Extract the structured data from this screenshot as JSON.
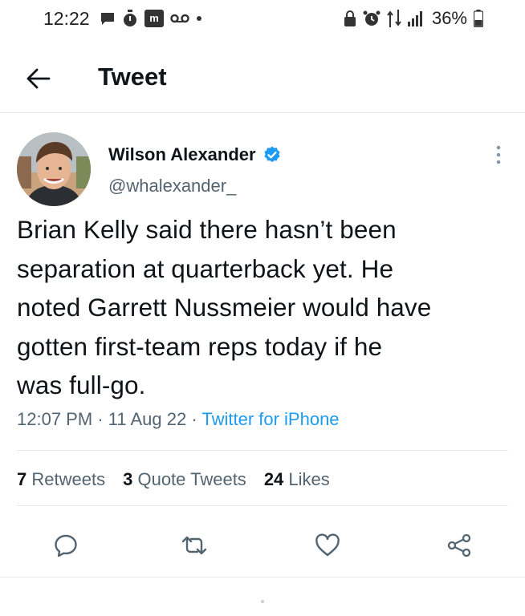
{
  "status_bar": {
    "time": "12:22",
    "battery": "36%",
    "left_icons": [
      "chat-bubble-icon",
      "timer-icon",
      "m-app-icon",
      "voicemail-icon",
      "dot-icon"
    ],
    "right_icons": [
      "lock-icon",
      "alarm-icon",
      "data-icon",
      "signal-icon",
      "battery-icon"
    ]
  },
  "app_bar": {
    "title": "Tweet"
  },
  "tweet": {
    "author_name": "Wilson Alexander",
    "author_handle": "@whalexander_",
    "verified": true,
    "text_lines": [
      "Brian Kelly said there hasn’t been",
      "separation at quarterback yet. He",
      "noted Garrett Nussmeier would have",
      "gotten first-team reps today if he",
      "was full-go."
    ],
    "time": "12:07 PM",
    "sep1": " · ",
    "date": "11 Aug 22",
    "sep2": " · ",
    "source": "Twitter for iPhone"
  },
  "stats": {
    "retweets_count": "7",
    "retweets_label": "Retweets",
    "quotes_count": "3",
    "quotes_label": "Quote Tweets",
    "likes_count": "24",
    "likes_label": "Likes"
  },
  "actions": [
    "reply-icon",
    "retweet-icon",
    "like-icon",
    "share-icon"
  ],
  "colors": {
    "accent": "#1d9bf0",
    "text": "#0f1419",
    "secondary": "#536471",
    "divider": "#e6e9eb"
  }
}
